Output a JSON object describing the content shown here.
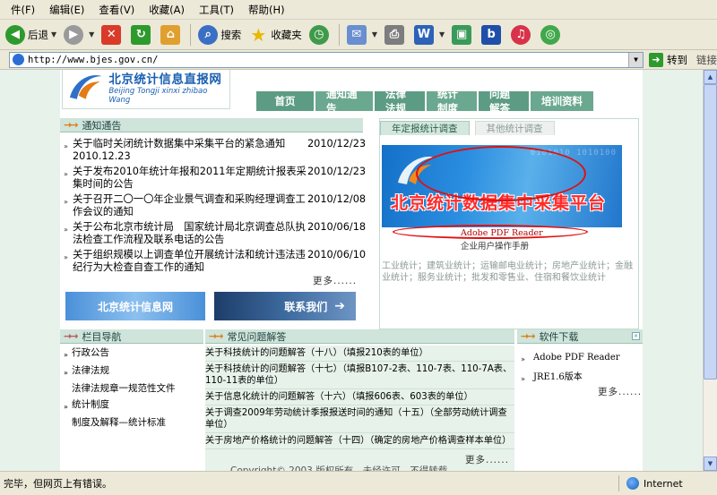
{
  "menubar": {
    "items": [
      "件(F)",
      "编辑(E)",
      "查看(V)",
      "收藏(A)",
      "工具(T)",
      "帮助(H)"
    ]
  },
  "toolbar": {
    "back": "后退",
    "search": "搜索",
    "favorites": "收藏夹"
  },
  "address": {
    "label": "",
    "url": "http://www.bjes.gov.cn/",
    "go": "转到",
    "links": "链接"
  },
  "site": {
    "logo_cn": "北京统计信息直报网",
    "logo_en": "Beijing Tongji xinxi zhibao Wang",
    "nav": [
      "首页",
      "通知通告",
      "法律法规",
      "统计制度",
      "问题解答",
      "培训资料"
    ]
  },
  "notices": {
    "header": "通知通告",
    "items": [
      {
        "title": "关于临时关闭统计数据集中采集平台的紧急通知 2010.12.23",
        "date": "2010/12/23"
      },
      {
        "title": "关于发布2010年统计年报和2011年定期统计报表采集时间的公告",
        "date": "2010/12/23"
      },
      {
        "title": "关于召开二〇一〇年企业景气调查和采购经理调查工作会议的通知",
        "date": "2010/12/08"
      },
      {
        "title": "关于公布北京市统计局　国家统计局北京调查总队执法检查工作流程及联系电话的公告",
        "date": "2010/06/18"
      },
      {
        "title": "关于组织规模以上调查单位开展统计法和统计违法违纪行为大检查自查工作的通知",
        "date": "2010/06/10"
      }
    ],
    "more": "更多......"
  },
  "banners": {
    "info_net": "北京统计信息网",
    "contact": "联系我们"
  },
  "right_box": {
    "tab_active": "年定报统计调查",
    "tab_inactive": "其他统计调查",
    "promo_title": "北京统计数据集中采集平台",
    "promo_bits": "0101010 1010100",
    "pdf_reader": "Adobe PDF Reader",
    "manual": "企业用户操作手册",
    "categories": "工业统计；建筑业统计；运输邮电业统计；房地产业统计；金融业统计；服务业统计；批发和零售业、住宿和餐饮业统计"
  },
  "nav_column": {
    "header": "栏目导航",
    "items": [
      {
        "text": "行政公告",
        "bullet": true
      },
      {
        "text": "法律法规",
        "bullet": true
      },
      {
        "text": "法律法规章一规范性文件",
        "bullet": false
      },
      {
        "text": "统计制度",
        "bullet": true
      },
      {
        "text": "制度及解释—统计标准",
        "bullet": false
      }
    ]
  },
  "faq": {
    "header": "常见问题解答",
    "items": [
      "关于科技统计的问题解答（十八）（填报210表的单位）",
      "关于科技统计的问题解答（十七）（填报B107-2表、110-7表、110-7A表、110-11表的单位）",
      "关于信息化统计的问题解答（十六）（填报606表、603表的单位）",
      "关于调查2009年劳动统计季报报送时间的通知（十五）（全部劳动统计调查单位）",
      "关于房地产价格统计的问题解答（十四）（确定的房地产价格调查样本单位）"
    ],
    "more": "更多......"
  },
  "software": {
    "header": "软件下载",
    "items": [
      "Adobe PDF Reader",
      "JRE1.6版本"
    ],
    "more": "更多......"
  },
  "footer": "Copyright© 2003 版权所有　未经许可　不得转载",
  "statusbar": {
    "text": "完毕，但网页上有错误。",
    "zone": "Internet"
  }
}
